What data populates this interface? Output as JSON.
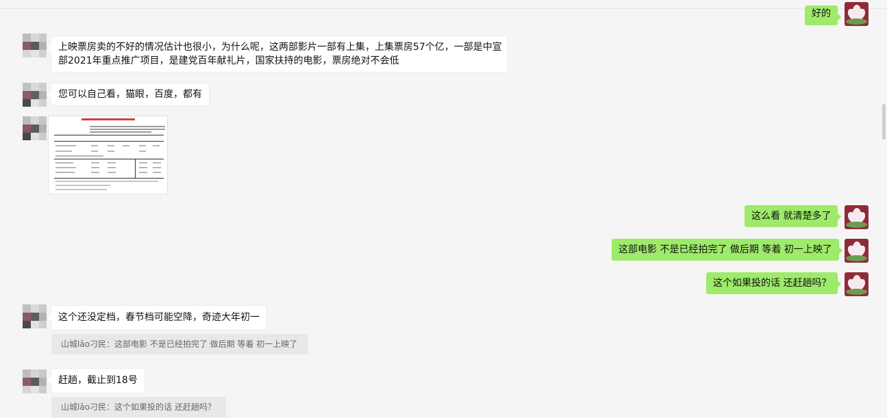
{
  "messages": [
    {
      "side": "right",
      "text": "好的"
    },
    {
      "side": "left",
      "lines": [
        "上映票房卖的不好的情况估计也很小，为什么呢，这两部影片一部有上集，上集票房57个亿，一部是中宣",
        "部2021年重点推广项目，是建党百年献礼片，国家扶持的电影，票房绝对不会低"
      ]
    },
    {
      "side": "left",
      "text": "您可以自己看，猫眼，百度，都有"
    },
    {
      "side": "left",
      "type": "image",
      "description": "document-screenshot"
    },
    {
      "side": "right",
      "text": "这么看 就清楚多了"
    },
    {
      "side": "right",
      "text": "这部电影 不是已经拍完了 做后期 等着 初一上映了"
    },
    {
      "side": "right",
      "text": "这个如果投的话 还赶趟吗？"
    },
    {
      "side": "left",
      "text": "这个还没定档，春节档可能空降，奇迹大年初一",
      "quote": "山城lǎo刁民：这部电影 不是已经拍完了 做后期 等着 初一上映了"
    },
    {
      "side": "left",
      "text": "赶趟，截止到18号",
      "quote": "山城lǎo刁民：这个如果投的话 还赶趟吗？"
    }
  ],
  "avatars": {
    "self": "lotus-avatar",
    "other": "pixelated-avatar"
  },
  "colors": {
    "background": "#f5f5f5",
    "outgoing_bubble": "#9eea6a",
    "incoming_bubble": "#ffffff",
    "quote_background": "#e8e8e8"
  }
}
